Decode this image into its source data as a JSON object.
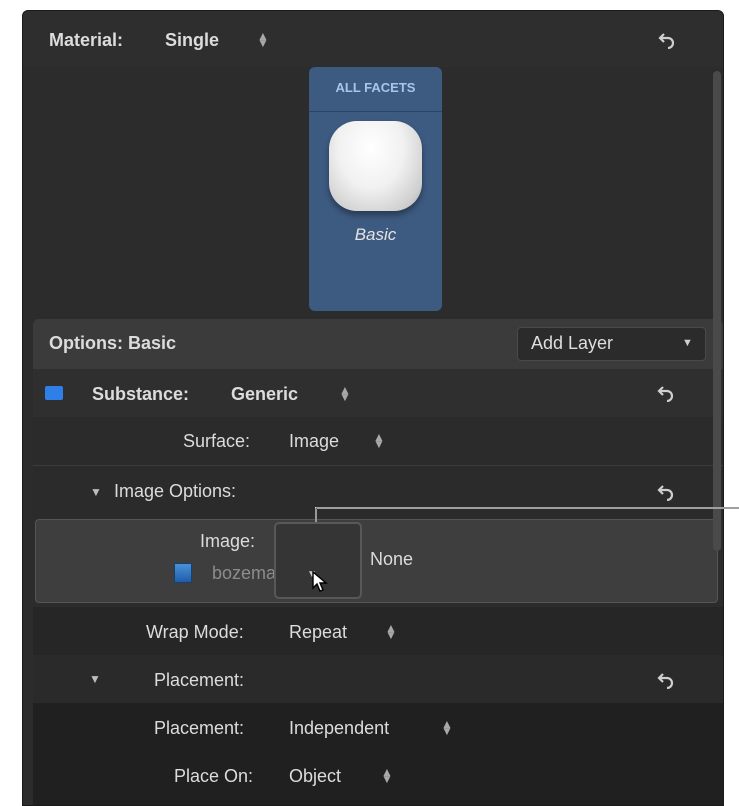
{
  "material": {
    "label": "Material:",
    "value": "Single"
  },
  "facets": {
    "header": "ALL FACETS",
    "swatch_label": "Basic"
  },
  "options": {
    "label": "Options: Basic",
    "add_layer": "Add Layer"
  },
  "substance": {
    "label": "Substance:",
    "value": "Generic"
  },
  "surface": {
    "label": "Surface:",
    "value": "Image"
  },
  "image_options": {
    "label": "Image Options:"
  },
  "image": {
    "label": "Image:",
    "source": "bozeman",
    "value": "None"
  },
  "wrap_mode": {
    "label": "Wrap Mode:",
    "value": "Repeat"
  },
  "placement_group": {
    "label": "Placement:"
  },
  "placement": {
    "label": "Placement:",
    "value": "Independent"
  },
  "place_on": {
    "label": "Place On:",
    "value": "Object"
  },
  "colors": {
    "panel": "#2c2c2c",
    "facet_blue": "#3d5a80",
    "accent_blue": "#2f7fe8"
  }
}
